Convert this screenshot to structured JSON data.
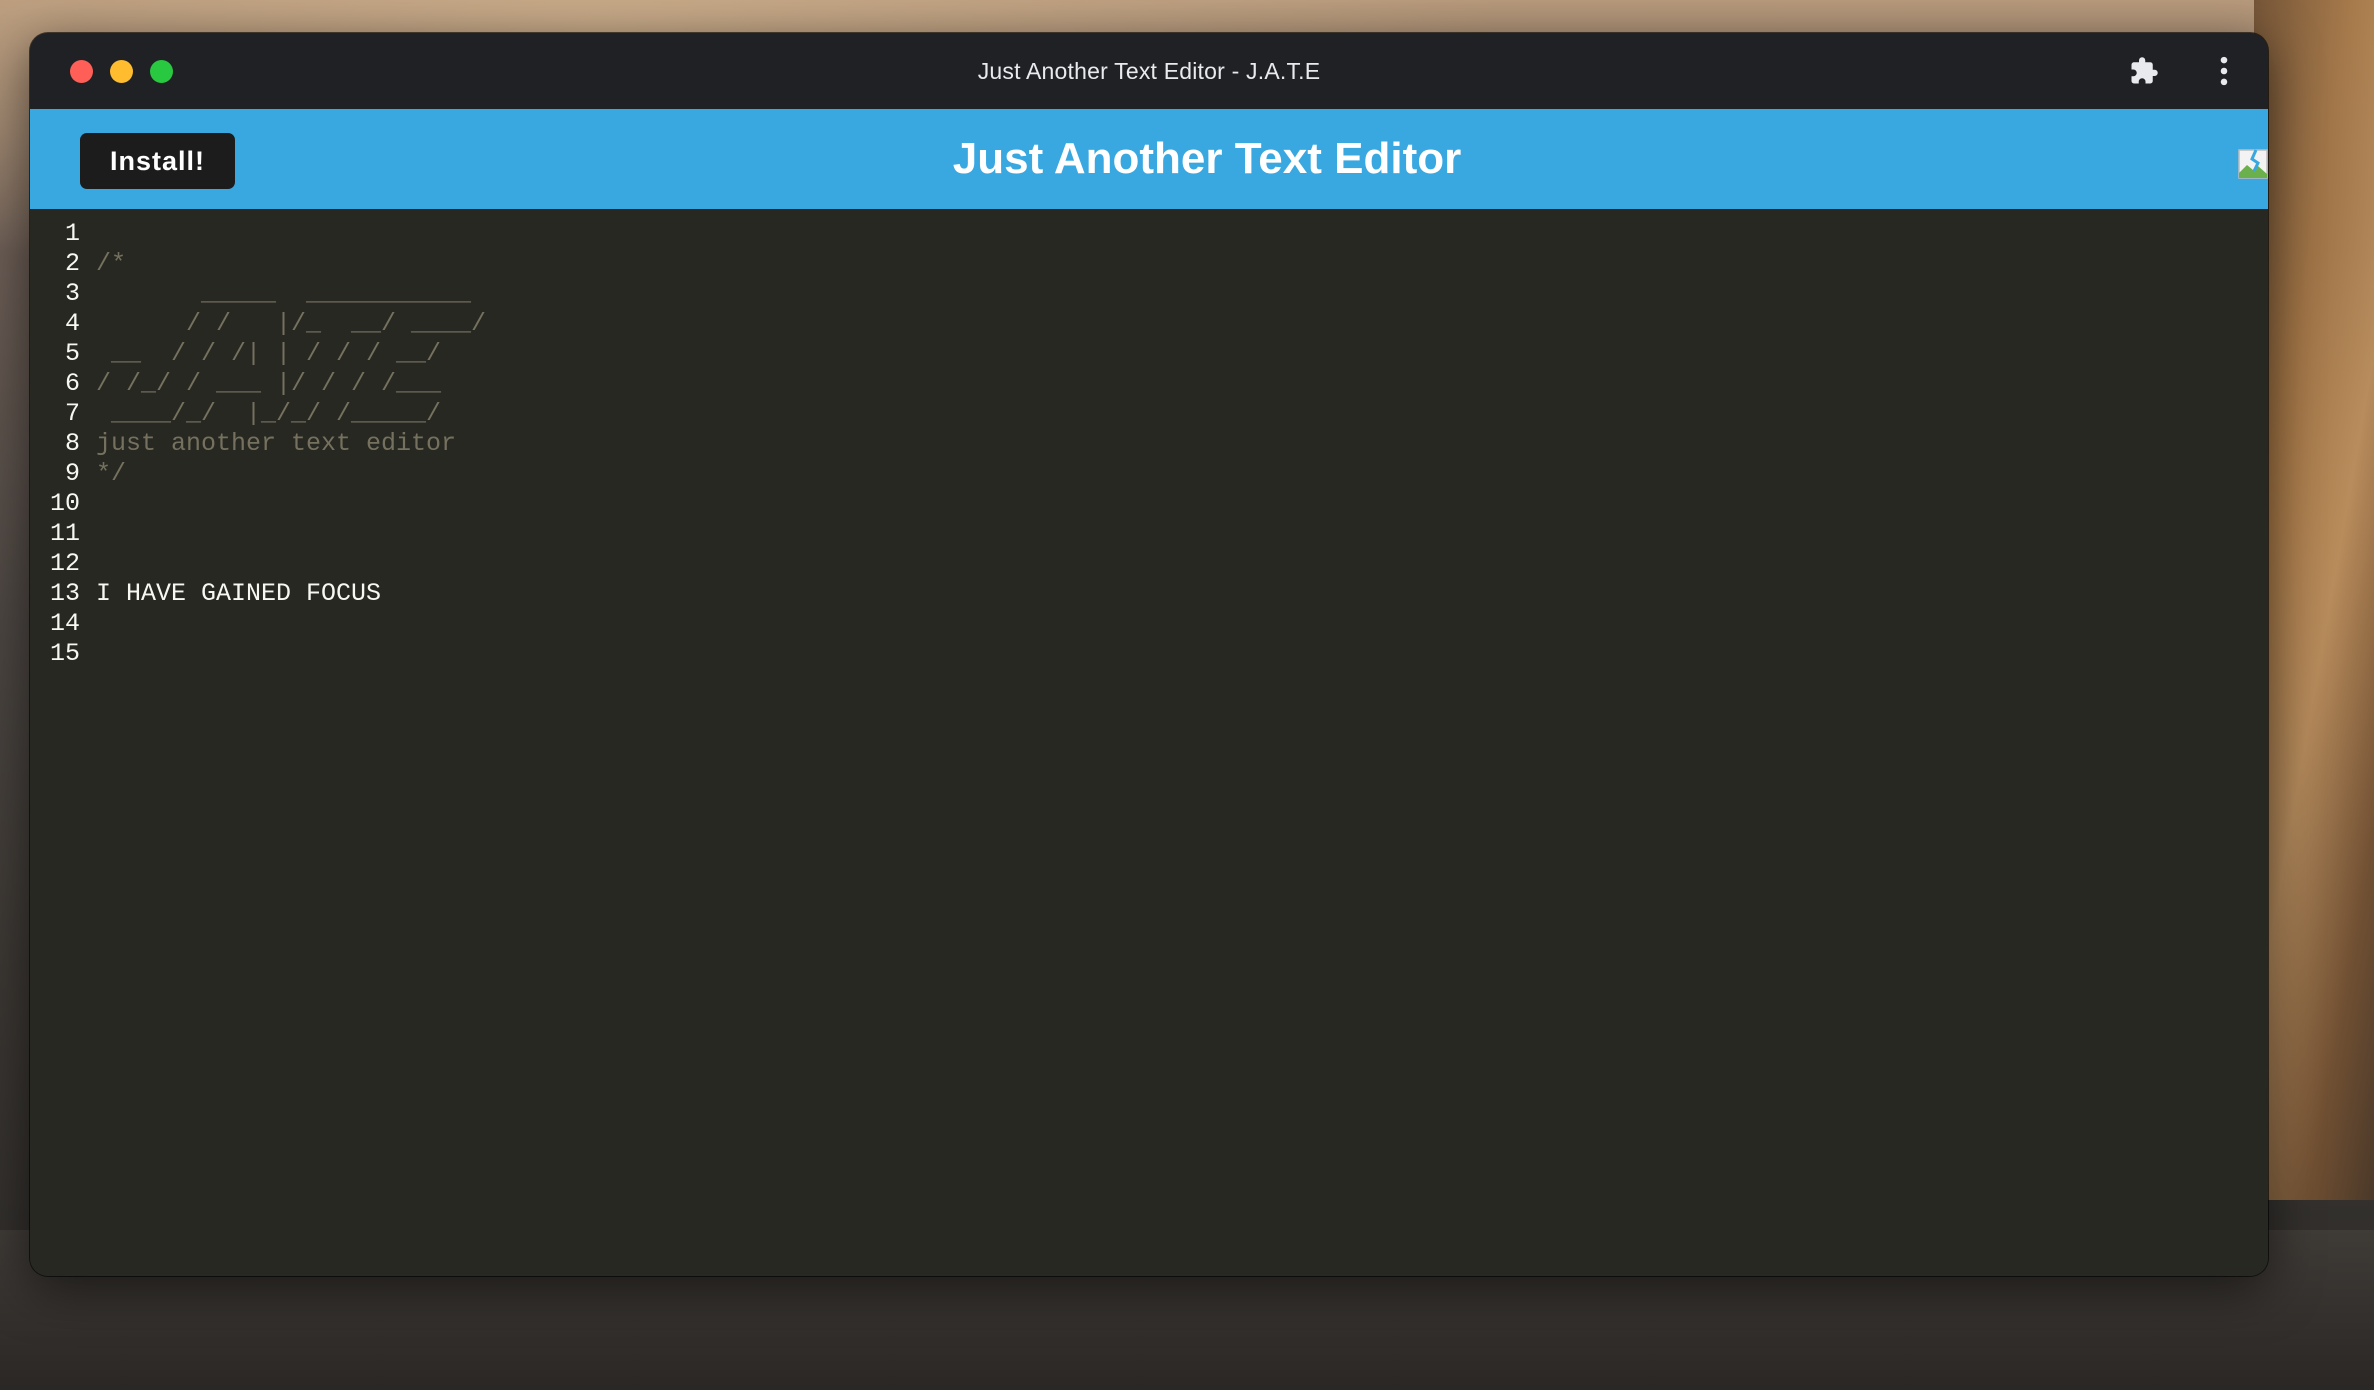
{
  "window": {
    "title": "Just Another Text Editor - J.A.T.E"
  },
  "header": {
    "install_label": "Install!",
    "title": "Just Another Text Editor"
  },
  "icons": {
    "extensions": "puzzle-piece-icon",
    "menu": "three-dots-vertical-icon",
    "broken_image": "broken-image-icon"
  },
  "colors": {
    "header_bg": "#3aa8e0",
    "editor_bg": "#272822",
    "comment": "#75715e",
    "text": "#f8f8f2",
    "titlebar_bg": "#202124"
  },
  "editor": {
    "lines": [
      {
        "n": "1",
        "text": "",
        "kind": "code"
      },
      {
        "n": "2",
        "text": "/*",
        "kind": "comment"
      },
      {
        "n": "3",
        "text": "       _____  ___________",
        "kind": "comment"
      },
      {
        "n": "4",
        "text": "      / /   |/_  __/ ____/",
        "kind": "comment"
      },
      {
        "n": "5",
        "text": " __  / / /| | / / / __/",
        "kind": "comment"
      },
      {
        "n": "6",
        "text": "/ /_/ / ___ |/ / / /___",
        "kind": "comment"
      },
      {
        "n": "7",
        "text": " ____/_/  |_/_/ /_____/",
        "kind": "comment"
      },
      {
        "n": "8",
        "text": "just another text editor",
        "kind": "comment"
      },
      {
        "n": "9",
        "text": "*/",
        "kind": "comment"
      },
      {
        "n": "10",
        "text": "",
        "kind": "code"
      },
      {
        "n": "11",
        "text": "",
        "kind": "code"
      },
      {
        "n": "12",
        "text": "",
        "kind": "code"
      },
      {
        "n": "13",
        "text": "I HAVE GAINED FOCUS",
        "kind": "code"
      },
      {
        "n": "14",
        "text": "",
        "kind": "code"
      },
      {
        "n": "15",
        "text": "",
        "kind": "code"
      }
    ]
  }
}
